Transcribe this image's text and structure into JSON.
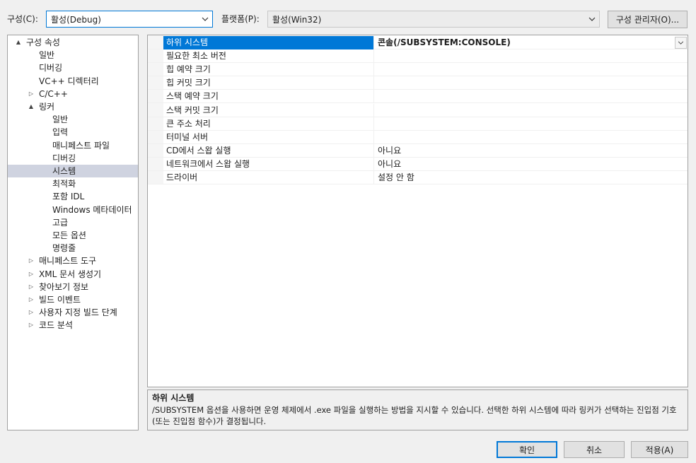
{
  "toolbar": {
    "config_label": "구성(C):",
    "config_value": "활성(Debug)",
    "platform_label": "플랫폼(P):",
    "platform_value": "활성(Win32)",
    "config_manager_button": "구성 관리자(O)..."
  },
  "tree": {
    "items": [
      {
        "label": "구성 속성",
        "arrow": "▲"
      },
      {
        "label": "일반"
      },
      {
        "label": "디버깅"
      },
      {
        "label": "VC++ 디렉터리"
      },
      {
        "label": "C/C++",
        "arrow": "▷"
      },
      {
        "label": "링커",
        "arrow": "▲"
      },
      {
        "label": "일반"
      },
      {
        "label": "입력"
      },
      {
        "label": "매니페스트 파일"
      },
      {
        "label": "디버깅"
      },
      {
        "label": "시스템"
      },
      {
        "label": "최적화"
      },
      {
        "label": "포함 IDL"
      },
      {
        "label": "Windows 메타데이터"
      },
      {
        "label": "고급"
      },
      {
        "label": "모든 옵션"
      },
      {
        "label": "명령줄"
      },
      {
        "label": "매니페스트 도구",
        "arrow": "▷"
      },
      {
        "label": "XML 문서 생성기",
        "arrow": "▷"
      },
      {
        "label": "찾아보기 정보",
        "arrow": "▷"
      },
      {
        "label": "빌드 이벤트",
        "arrow": "▷"
      },
      {
        "label": "사용자 지정 빌드 단계",
        "arrow": "▷"
      },
      {
        "label": "코드 분석",
        "arrow": "▷"
      }
    ]
  },
  "grid": {
    "rows": [
      {
        "name": "하위 시스템",
        "value": "콘솔(/SUBSYSTEM:CONSOLE)"
      },
      {
        "name": "필요한 최소 버전",
        "value": ""
      },
      {
        "name": "힙 예약 크기",
        "value": ""
      },
      {
        "name": "힙 커밋 크기",
        "value": ""
      },
      {
        "name": "스택 예약 크기",
        "value": ""
      },
      {
        "name": "스택 커밋 크기",
        "value": ""
      },
      {
        "name": "큰 주소 처리",
        "value": ""
      },
      {
        "name": "터미널 서버",
        "value": ""
      },
      {
        "name": "CD에서 스왑 실행",
        "value": "아니요"
      },
      {
        "name": "네트워크에서 스왑 실행",
        "value": "아니요"
      },
      {
        "name": "드라이버",
        "value": "설정 안 함"
      }
    ],
    "dropdown_icon": "chevron-down-icon"
  },
  "description": {
    "title": "하위 시스템",
    "text": "/SUBSYSTEM 옵션을 사용하면 운영 체제에서 .exe 파일을 실행하는 방법을 지시할 수 있습니다. 선택한 하위 시스템에 따라 링커가 선택하는 진입점 기호(또는 진입점 함수)가 결정됩니다."
  },
  "buttons": {
    "ok": "확인",
    "cancel": "취소",
    "apply": "적용(A)"
  },
  "colors": {
    "accent": "#0078d7",
    "tree_selection": "#cfd3e0"
  }
}
